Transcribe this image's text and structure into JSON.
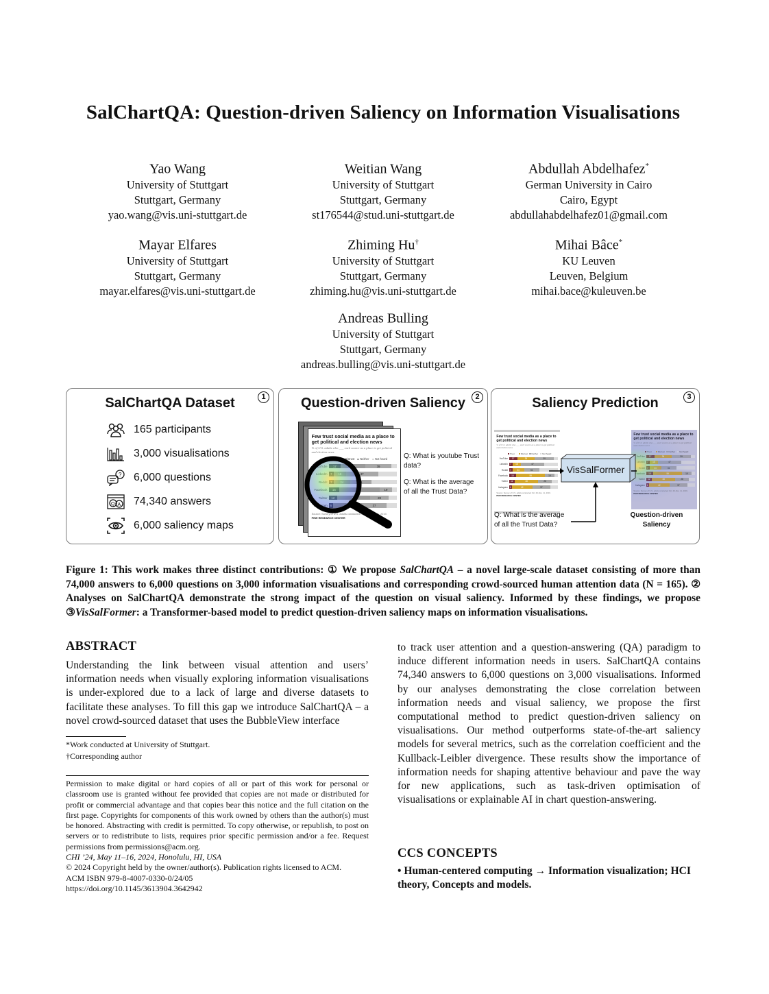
{
  "paper": {
    "title": "SalChartQA: Question-driven Saliency on Information Visualisations",
    "authors": [
      {
        "name": "Yao Wang",
        "mark": "",
        "affiliation": "University of Stuttgart",
        "location": "Stuttgart, Germany",
        "email": "yao.wang@vis.uni-stuttgart.de"
      },
      {
        "name": "Weitian Wang",
        "mark": "",
        "affiliation": "University of Stuttgart",
        "location": "Stuttgart, Germany",
        "email": "st176544@stud.uni-stuttgart.de"
      },
      {
        "name": "Abdullah Abdelhafez",
        "mark": "*",
        "affiliation": "German University in Cairo",
        "location": "Cairo, Egypt",
        "email": "abdullahabdelhafez01@gmail.com"
      },
      {
        "name": "Mayar Elfares",
        "mark": "",
        "affiliation": "University of Stuttgart",
        "location": "Stuttgart, Germany",
        "email": "mayar.elfares@vis.uni-stuttgart.de"
      },
      {
        "name": "Zhiming Hu",
        "mark": "†",
        "affiliation": "University of Stuttgart",
        "location": "Stuttgart, Germany",
        "email": "zhiming.hu@vis.uni-stuttgart.de"
      },
      {
        "name": "Mihai Bâce",
        "mark": "*",
        "affiliation": "KU Leuven",
        "location": "Leuven, Belgium",
        "email": "mihai.bace@kuleuven.be"
      },
      {
        "name": "Andreas Bulling",
        "mark": "",
        "affiliation": "University of Stuttgart",
        "location": "Stuttgart, Germany",
        "email": "andreas.bulling@vis.uni-stuttgart.de"
      }
    ]
  },
  "figure": {
    "panel1": {
      "title": "SalChartQA Dataset",
      "number": "1",
      "stats": [
        {
          "icon": "participants-icon",
          "label": "165 participants"
        },
        {
          "icon": "bar-chart-icon",
          "label": "3,000 visualisations"
        },
        {
          "icon": "question-bubble-icon",
          "label": "6,000 questions"
        },
        {
          "icon": "qa-window-icon",
          "label": "74,340 answers"
        },
        {
          "icon": "eye-focus-icon",
          "label": "6,000 saliency maps"
        }
      ]
    },
    "panel2": {
      "title": "Question-driven Saliency",
      "number": "2",
      "questions": [
        "Q: What is youtube Trust data?",
        "Q: What is the average of all the Trust Data?"
      ]
    },
    "panel3": {
      "title": "Saliency Prediction",
      "number": "3",
      "model": "VisSalFormer",
      "question": "Q: What is the average of all the Trust Data?",
      "output_label": "Question-driven Saliency"
    },
    "mini_chart": {
      "title": "Few trust social media as a place to get political and election news",
      "subtitle": "% of U.S. adults who ___ each source as a place to get political and election news",
      "legend": [
        "Trust",
        "Distrust",
        "Neither",
        "Not heard"
      ],
      "rows": [
        {
          "label": "YouTube",
          "trust": 17,
          "distrust": 36,
          "neither": 39
        },
        {
          "label": "LinkedIn",
          "trust": 7,
          "distrust": 18,
          "neither": 47
        },
        {
          "label": "Reddit",
          "trust": 7,
          "distrust": 24,
          "neither": 31
        },
        {
          "label": "Facebook",
          "trust": 15,
          "distrust": 59,
          "neither": 19
        },
        {
          "label": "Twitter",
          "trust": 12,
          "distrust": 48,
          "neither": 28
        },
        {
          "label": "Instagram",
          "trust": 6,
          "distrust": 42,
          "neither": 37
        }
      ],
      "source": "Source: Survey of U.S. adults conducted Oct. 29-Nov. 11, 2019.",
      "org": "PEW RESEARCH CENTER"
    },
    "caption_parts": {
      "lead": "Figure 1: This work makes three distinct contributions: ① We propose ",
      "name1": "SalChartQA",
      "mid1": " – a novel large-scale dataset consisting of more than 74,000 answers to 6,000 questions on 3,000 information visualisations and corresponding crowd-sourced human attention data (N = 165). ② Analyses on SalChartQA demonstrate the strong impact of the question on visual saliency. Informed by these findings, we propose ③",
      "name2": "VisSalFormer",
      "tail": ": a Transformer-based model to predict question-driven saliency maps on information visualisations."
    }
  },
  "abstract": {
    "heading": "ABSTRACT",
    "col1": "Understanding the link between visual attention and users’ information needs when visually exploring information visualisations is under-explored due to a lack of large and diverse datasets to facilitate these analyses. To fill this gap we introduce SalChartQA – a novel crowd-sourced dataset that uses the BubbleView interface",
    "col2": "to track user attention and a question-answering (QA) paradigm to induce different information needs in users. SalChartQA contains 74,340 answers to 6,000 questions on 3,000 visualisations. Informed by our analyses demonstrating the close correlation between information needs and visual saliency, we propose the first computational method to predict question-driven saliency on visualisations. Our method outperforms state-of-the-art saliency models for several metrics, such as the correlation coefficient and the Kullback-Leibler divergence. These results show the importance of information needs for shaping attentive behaviour and pave the way for new applications, such as task-driven optimisation of visualisations or explainable AI in chart question-answering."
  },
  "footnotes": {
    "star": "*Work conducted at University of Stuttgart.",
    "dagger": "†Corresponding author"
  },
  "permission": {
    "text": "Permission to make digital or hard copies of all or part of this work for personal or classroom use is granted without fee provided that copies are not made or distributed for profit or commercial advantage and that copies bear this notice and the full citation on the first page. Copyrights for components of this work owned by others than the author(s) must be honored. Abstracting with credit is permitted. To copy otherwise, or republish, to post on servers or to redistribute to lists, requires prior specific permission and/or a fee. Request permissions from permissions@acm.org.",
    "venue": "CHI ’24, May 11–16, 2024, Honolulu, HI, USA",
    "copyright": "© 2024 Copyright held by the owner/author(s). Publication rights licensed to ACM.",
    "isbn": "ACM ISBN 979-8-4007-0330-0/24/05",
    "doi": "https://doi.org/10.1145/3613904.3642942"
  },
  "ccs": {
    "heading": "CCS CONCEPTS",
    "text": "• Human-centered computing → Information visualization; HCI theory, Concepts and models."
  },
  "colors": {
    "trust_pewgray": "#3d3d4f",
    "trust_red": "#7a2a35",
    "distrust_gray": "#9a9a9a",
    "distrust_gold": "#d4a72c",
    "neither": "#a8a8a8",
    "not_heard": "#dcdcdc",
    "model_box": "#cfe0f0"
  }
}
